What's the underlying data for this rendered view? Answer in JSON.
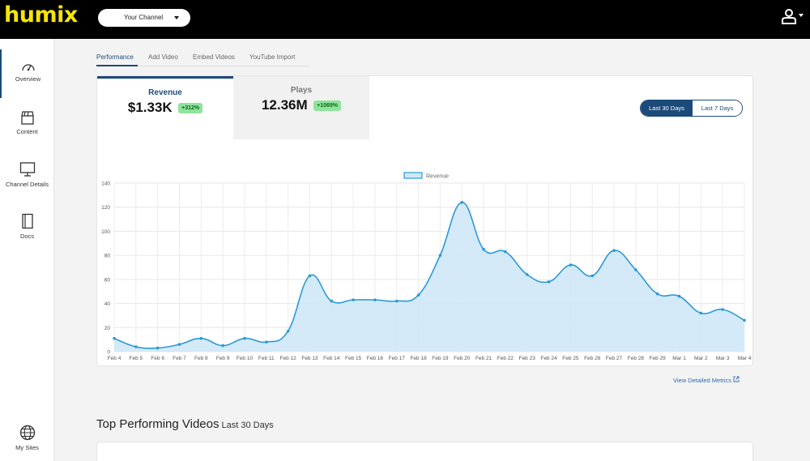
{
  "app": {
    "logo_text": "humix",
    "channel_select": "Your Channel"
  },
  "sidebar": {
    "items": [
      {
        "label": "Overview",
        "icon": "gauge-icon"
      },
      {
        "label": "Content",
        "icon": "clapperboard-icon"
      },
      {
        "label": "Channel Details",
        "icon": "monitor-icon"
      },
      {
        "label": "Docs",
        "icon": "book-icon"
      },
      {
        "label": "My Sites",
        "icon": "globe-icon"
      }
    ]
  },
  "tabs": [
    "Performance",
    "Add Video",
    "Embed Videos",
    "YouTube Import"
  ],
  "metrics": {
    "revenue": {
      "label": "Revenue",
      "value": "$1.33K",
      "change": "+312%"
    },
    "plays": {
      "label": "Plays",
      "value": "12.36M",
      "change": "+1069%"
    }
  },
  "range": {
    "selected": "Last 30 Days",
    "other": "Last 7 Days"
  },
  "chart_data": {
    "type": "area",
    "series": [
      {
        "name": "Revenue",
        "color": "#2a9ad6"
      }
    ],
    "x": [
      "Feb 4",
      "Feb 5",
      "Feb 6",
      "Feb 7",
      "Feb 8",
      "Feb 9",
      "Feb 10",
      "Feb 11",
      "Feb 12",
      "Feb 13",
      "Feb 14",
      "Feb 15",
      "Feb 16",
      "Feb 17",
      "Feb 18",
      "Feb 19",
      "Feb 20",
      "Feb 21",
      "Feb 22",
      "Feb 23",
      "Feb 24",
      "Feb 25",
      "Feb 26",
      "Feb 27",
      "Feb 28",
      "Feb 29",
      "Mar 1",
      "Mar 2",
      "Mar 3",
      "Mar 4"
    ],
    "values": [
      11,
      4,
      3,
      6,
      11,
      5,
      11,
      8,
      17,
      63,
      42,
      43,
      43,
      42,
      47,
      80,
      124,
      85,
      83,
      64,
      58,
      72,
      63,
      84,
      68,
      48,
      46,
      32,
      35,
      26
    ],
    "ylim": [
      0,
      140
    ],
    "yticks": [
      0,
      20,
      40,
      60,
      80,
      100,
      120,
      140
    ],
    "grid": true,
    "legend": "top-center"
  },
  "links": {
    "detailed_metrics": "View Detailed Metrics"
  },
  "section": {
    "title": "Top Performing Videos",
    "subtitle": "Last 30 Days"
  }
}
